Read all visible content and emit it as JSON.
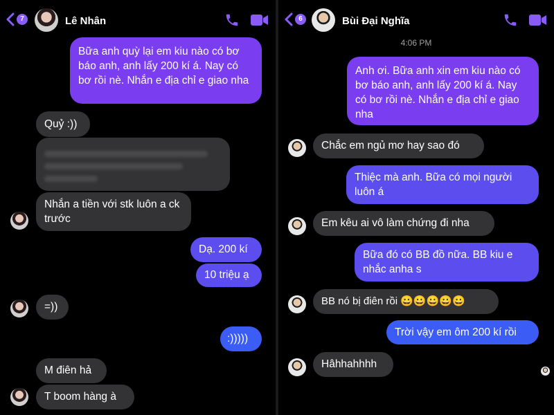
{
  "left": {
    "header": {
      "back_count": "7",
      "contact_name": "Lê Nhân"
    },
    "messages": {
      "m1": "Bữa anh quỳ lại em kiu nào có bơ báo anh, anh lấy 200 kí á. Nay có bơ rồi nè. Nhắn e địa chỉ e giao nha",
      "m2": "Quỷ :))",
      "m4": "Nhắn a tiền với stk luôn a ck trước",
      "m5": "Dạ. 200 kí",
      "m6": "10 triệu ạ",
      "m7": "=))",
      "m8": ":)))))",
      "m9": "M điên hả",
      "m10": "T boom hàng à"
    }
  },
  "right": {
    "header": {
      "back_count": "6",
      "contact_name": "Bùi Đại Nghĩa"
    },
    "timestamp": "4:06 PM",
    "messages": {
      "m1": "Anh ơi. Bữa anh xin em kiu nào có bơ báo anh, anh lấy 200 kí á. Nay có bơ rồi nè. Nhắn e địa chỉ e giao nha",
      "m2": "Chắc em ngủ mơ hay sao đó",
      "m3": "Thiệc mà anh. Bữa có mọi người luôn á",
      "m4": "Em kêu ai vô làm chứng đi nha",
      "m5": "Bữa đó có BB đồ nữa. BB kiu e nhắc anha s",
      "m6": "BB nó bị điên rồi 😀😀😀😀😀",
      "m7": "Trời vậy em ôm 200 kí rồi",
      "m8": "Hâhhahhhh"
    }
  },
  "colors": {
    "sent_purple": "#7a3df0",
    "sent_indigo": "#5b4dee",
    "sent_blue": "#3b5cf5",
    "received_gray": "#333335",
    "accent": "#8a5cf6"
  },
  "icons": [
    "chevron-left-icon",
    "phone-icon",
    "video-camera-icon"
  ]
}
